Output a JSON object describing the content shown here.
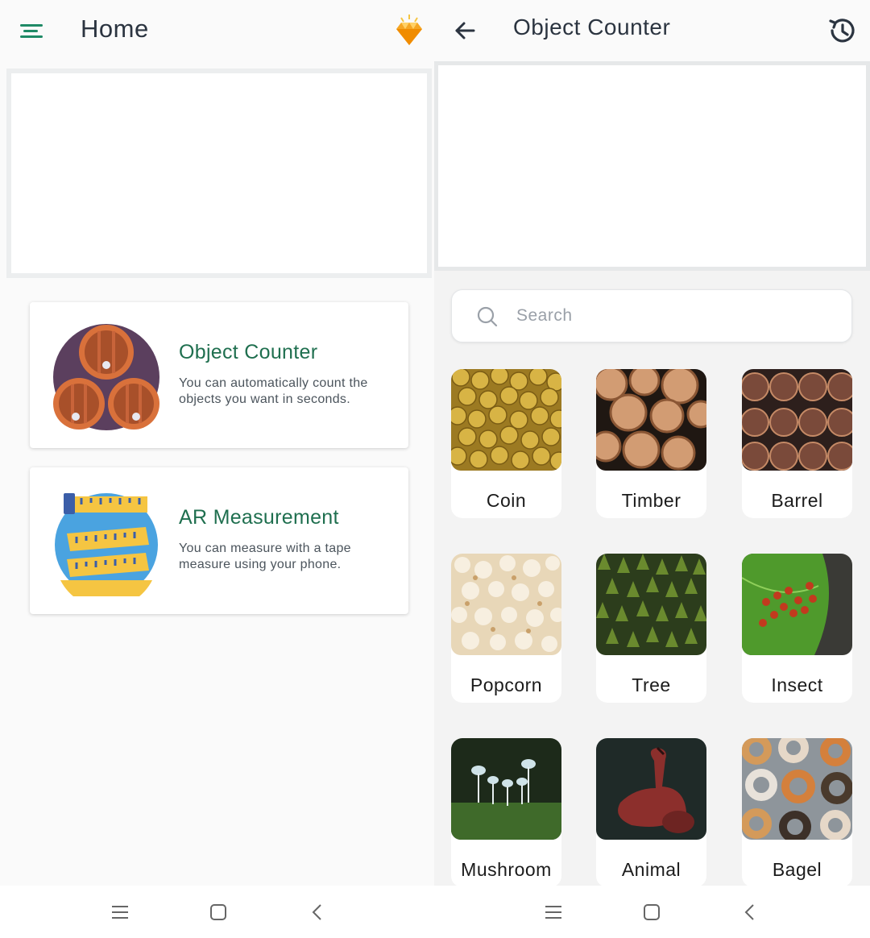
{
  "left": {
    "header": {
      "title": "Home"
    },
    "cards": [
      {
        "title": "Object Counter",
        "description": "You can automatically count the objects you want in seconds."
      },
      {
        "title": "AR Measurement",
        "description": "You can measure with a tape measure using your phone."
      }
    ]
  },
  "right": {
    "header": {
      "title": "Object Counter"
    },
    "search": {
      "placeholder": "Search",
      "value": ""
    },
    "categories": [
      {
        "label": "Coin"
      },
      {
        "label": "Timber"
      },
      {
        "label": "Barrel"
      },
      {
        "label": "Popcorn"
      },
      {
        "label": "Tree"
      },
      {
        "label": "Insect"
      },
      {
        "label": "Mushroom"
      },
      {
        "label": "Animal"
      },
      {
        "label": "Bagel"
      }
    ]
  },
  "icons": {
    "menu": "menu-icon",
    "premium": "gem-icon",
    "back": "back-arrow-icon",
    "history": "history-icon",
    "search": "search-icon",
    "nav_recents": "recents-icon",
    "nav_home": "home-icon",
    "nav_back": "nav-back-icon"
  },
  "colors": {
    "accent_green": "#1f6f4f",
    "title_dark": "#2b3440",
    "text_gray": "#4b545c",
    "gem_gold": "#f5a623"
  }
}
